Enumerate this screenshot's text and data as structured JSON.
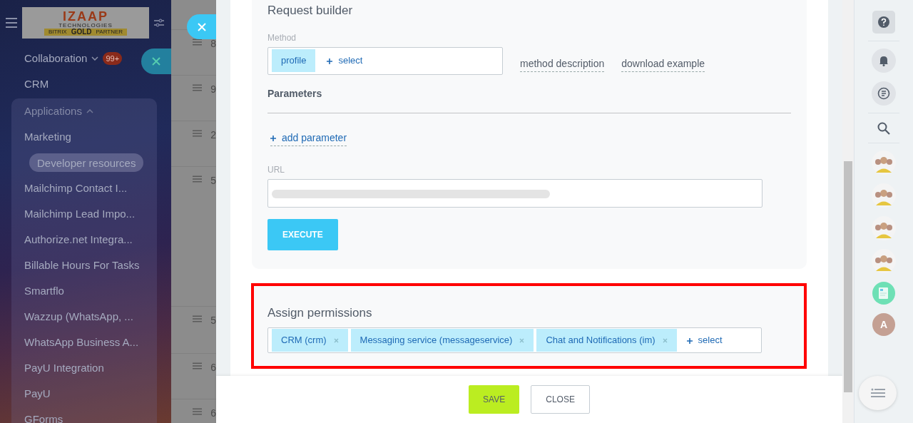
{
  "logo": {
    "lines": [
      "IZAAP",
      "TECHNOLOGIES",
      "BITRIX",
      "GOLD",
      "PARTNER"
    ]
  },
  "sidebar": {
    "items": [
      {
        "label": "Collaboration",
        "kind": "group",
        "expanded": false,
        "counter": "99+",
        "selected": false
      },
      {
        "label": "CRM",
        "kind": "link",
        "selected": false
      },
      {
        "label": "Applications",
        "kind": "group",
        "expanded": true,
        "selected": false,
        "children": [
          {
            "label": "Marketing",
            "selected": false
          },
          {
            "label": "Developer resources",
            "selected": true
          },
          {
            "label": "Mailchimp Contact I...",
            "selected": false
          },
          {
            "label": "Mailchimp Lead Impo...",
            "selected": false
          },
          {
            "label": "Authorize.net Integra...",
            "selected": false
          },
          {
            "label": "Billable Hours For Tasks",
            "selected": false
          },
          {
            "label": "Smartflo",
            "selected": false
          },
          {
            "label": "Wazzup (WhatsApp, ...",
            "selected": false
          },
          {
            "label": "WhatsApp Business A...",
            "selected": false
          },
          {
            "label": "PayU Integration",
            "selected": false
          },
          {
            "label": "PayU",
            "selected": false
          },
          {
            "label": "GForms",
            "selected": false
          }
        ]
      }
    ]
  },
  "background_list": {
    "rows": [
      {
        "text": "8"
      },
      {
        "text": "9"
      },
      {
        "text": "2"
      },
      {
        "text": "5"
      },
      {
        "text": "5"
      },
      {
        "text": "6"
      },
      {
        "text": "6"
      }
    ]
  },
  "request_builder": {
    "title": "Request builder",
    "method_label": "Method",
    "method_tags": [
      {
        "label": "profile"
      }
    ],
    "select": "select",
    "links": [
      "method description",
      "download example"
    ],
    "parameters_title": "Parameters",
    "add_parameter": "add parameter",
    "url_label": "URL",
    "execute": "EXECUTE"
  },
  "permissions": {
    "title": "Assign permissions",
    "highlighted": true,
    "tags": [
      {
        "label": "CRM (crm)"
      },
      {
        "label": "Messaging service (messageservice)"
      },
      {
        "label": "Chat and Notifications (im)"
      }
    ],
    "select": "select"
  },
  "footer": {
    "buttons": [
      {
        "label": "SAVE",
        "kind": "primary"
      },
      {
        "label": "CLOSE",
        "kind": "secondary"
      }
    ]
  },
  "right_bar": {
    "items": [
      {
        "kind": "help"
      },
      {
        "kind": "divider"
      },
      {
        "kind": "bell"
      },
      {
        "kind": "chat"
      },
      {
        "kind": "divider"
      },
      {
        "kind": "search"
      },
      {
        "kind": "divider"
      },
      {
        "kind": "group"
      },
      {
        "kind": "group"
      },
      {
        "kind": "group"
      },
      {
        "kind": "group"
      },
      {
        "kind": "news"
      },
      {
        "kind": "letter",
        "text": "A"
      }
    ]
  }
}
